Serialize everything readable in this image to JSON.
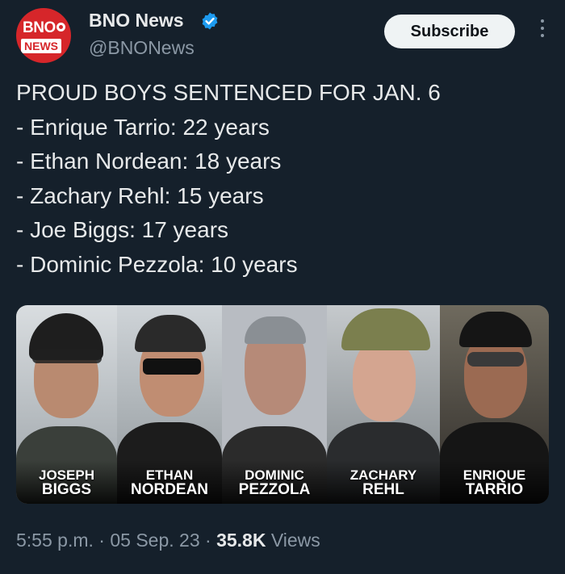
{
  "account": {
    "name": "BNO News",
    "handle": "@BNONews",
    "avatar_line1": "BNO",
    "avatar_line2": "NEWS",
    "verified_icon": "verified-badge-icon"
  },
  "actions": {
    "subscribe_label": "Subscribe",
    "more_icon": "more-vertical-icon"
  },
  "tweet": {
    "lines": [
      "PROUD BOYS SENTENCED FOR JAN. 6",
      "- Enrique Tarrio: 22 years",
      "- Ethan Nordean: 18 years",
      "- Zachary Rehl: 15 years",
      "- Joe Biggs: 17 years",
      "- Dominic Pezzola: 10 years"
    ]
  },
  "media": {
    "people": [
      {
        "first": "JOSEPH",
        "last": "BIGGS"
      },
      {
        "first": "ETHAN",
        "last": "NORDEAN"
      },
      {
        "first": "DOMINIC",
        "last": "PEZZOLA"
      },
      {
        "first": "ZACHARY",
        "last": "REHL"
      },
      {
        "first": "ENRIQUE",
        "last": "TARRIO"
      }
    ]
  },
  "meta": {
    "time": "5:55 p.m.",
    "sep1": " · ",
    "date": "05 Sep. 23",
    "sep2": " · ",
    "views_count": "35.8K",
    "views_label": " Views"
  },
  "colors": {
    "background": "#15202b",
    "text": "#e7e9ea",
    "secondary": "#8b98a5",
    "verified": "#1d9bf0",
    "brand": "#d6262a"
  }
}
